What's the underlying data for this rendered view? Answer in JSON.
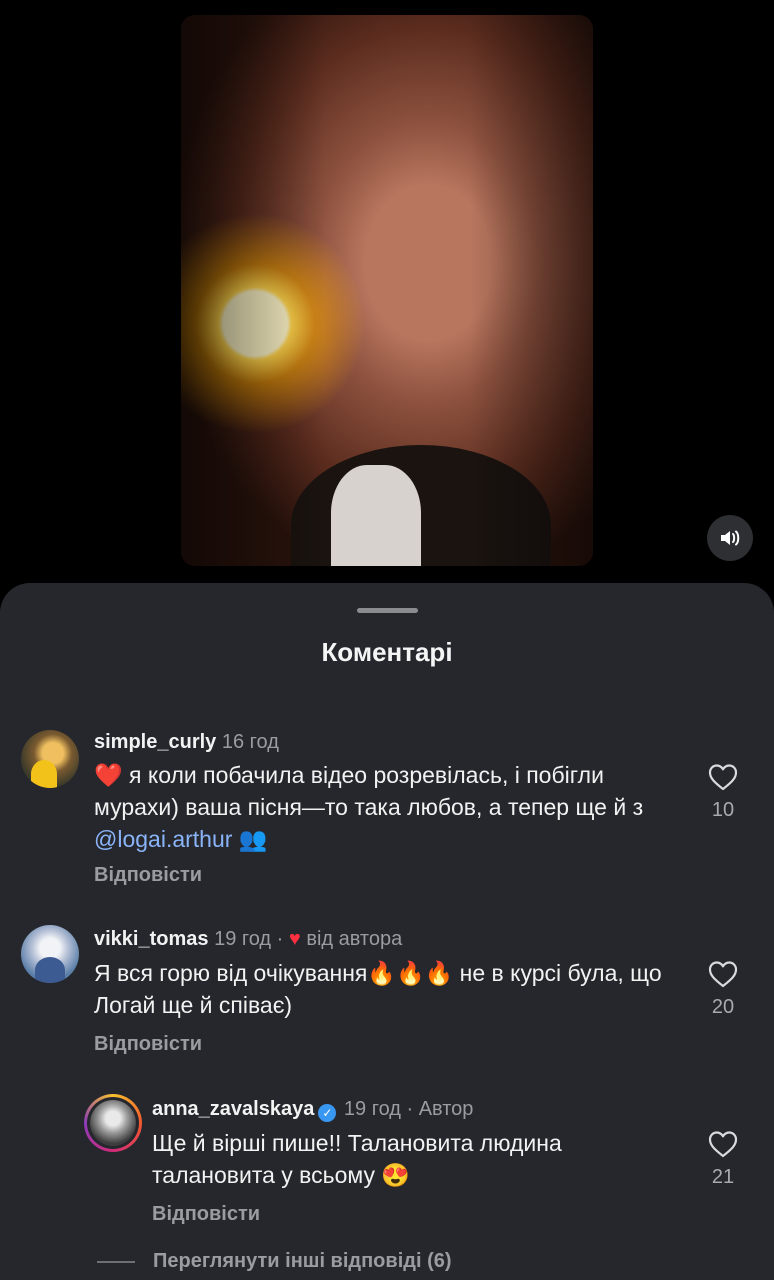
{
  "sheet": {
    "title": "Коментарі",
    "view_more": "Переглянути інші відповіді (6)"
  },
  "comments": [
    {
      "username": "simple_curly",
      "time": "16 год",
      "text_heart": "❤️",
      "text": "я коли побачила відео розревілась, і побігли мурахи) ваша пісня—то така любов, а тепер ще й з",
      "mention": "@logai.arthur",
      "text_end": "👥",
      "reply": "Відповісти",
      "likes": "10"
    },
    {
      "username": "vikki_tomas",
      "time": "19 год",
      "sep": "·",
      "liked_by_author_heart": "♥",
      "liked_by_author": "від автора",
      "text": "Я вся горю від очікування🔥🔥🔥 не в курсі була, що Логай ще й співає)",
      "reply": "Відповісти",
      "likes": "20"
    },
    {
      "username": "anna_zavalskaya",
      "verified": "✓",
      "time": "19 год",
      "sep": "·",
      "author_label": "Автор",
      "text": "Ще й вірші пише!! Талановита людина талановита у всьому 😍",
      "reply": "Відповісти",
      "likes": "21"
    }
  ],
  "icons": {
    "sound": "speaker-icon",
    "like": "heart-outline-icon"
  },
  "colors": {
    "sheet_bg": "#25272c",
    "mention": "#8ab4f8",
    "author_heart": "#ff3040",
    "verified": "#3897f0"
  }
}
